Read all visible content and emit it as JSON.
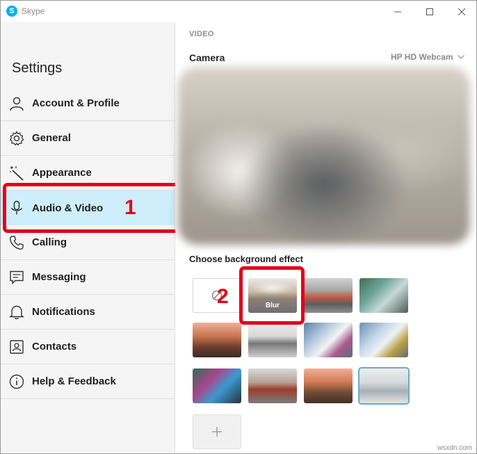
{
  "window": {
    "title": "Skype",
    "controls": {
      "minimize": "minimize-icon",
      "maximize": "maximize-icon",
      "close": "close-icon"
    }
  },
  "sidebar": {
    "title": "Settings",
    "items": [
      {
        "label": "Account & Profile",
        "icon": "person-icon"
      },
      {
        "label": "General",
        "icon": "gear-icon"
      },
      {
        "label": "Appearance",
        "icon": "magic-wand-icon"
      },
      {
        "label": "Audio & Video",
        "icon": "microphone-icon",
        "active": true
      },
      {
        "label": "Calling",
        "icon": "phone-icon"
      },
      {
        "label": "Messaging",
        "icon": "chat-icon"
      },
      {
        "label": "Notifications",
        "icon": "bell-icon"
      },
      {
        "label": "Contacts",
        "icon": "contact-card-icon"
      },
      {
        "label": "Help & Feedback",
        "icon": "info-icon"
      }
    ]
  },
  "main": {
    "section": "VIDEO",
    "camera_label": "Camera",
    "camera_device": "HP HD Webcam",
    "background_label": "Choose background effect",
    "blur_label": "Blur"
  },
  "annotations": {
    "one": "1",
    "two": "2"
  },
  "watermark": "wsxdn.com",
  "colors": {
    "accent_active": "#cdeefa",
    "annotation": "#e2001a",
    "skype_blue": "#00aff0"
  }
}
